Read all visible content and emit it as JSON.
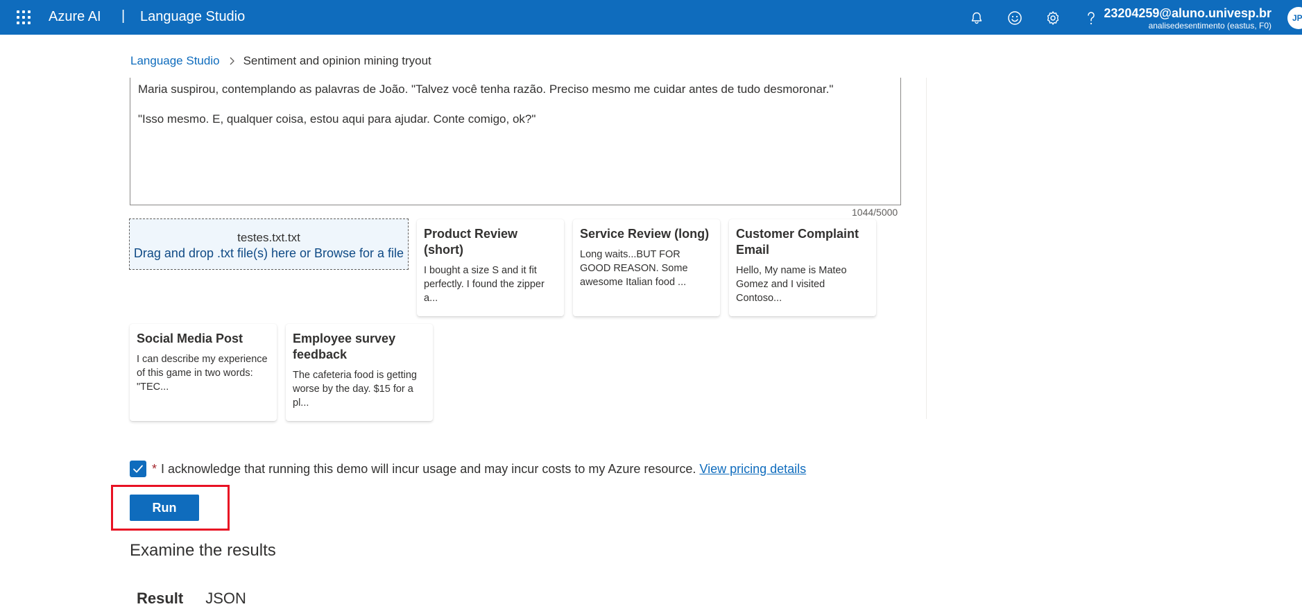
{
  "header": {
    "brand": "Azure AI",
    "separator": "|",
    "product": "Language Studio",
    "account_email": "23204259@aluno.univesp.br",
    "account_resource": "analisedesentimento (eastus, F0)",
    "avatar_initials": "JP",
    "icons": [
      "notifications-icon",
      "feedback-icon",
      "settings-icon",
      "help-icon"
    ]
  },
  "breadcrumb": {
    "root": "Language Studio",
    "current": "Sentiment and opinion mining tryout"
  },
  "editor": {
    "lines": [
      "Maria suspirou, contemplando as palavras de João. \"Talvez você tenha razão. Preciso mesmo me cuidar antes de tudo desmoronar.\"",
      "\"Isso mesmo. E, qualquer coisa, estou aqui para ajudar. Conte comigo, ok?\""
    ],
    "char_count": "1044/5000"
  },
  "upload": {
    "file_name": "testes.txt.txt",
    "hint": "Drag and drop .txt file(s) here or Browse for a file"
  },
  "samples": [
    {
      "title": "Product Review (short)",
      "body": "I bought a size S and it fit perfectly. I found the zipper a..."
    },
    {
      "title": "Service Review (long)",
      "body": "Long waits...BUT FOR GOOD REASON. Some awesome Italian food ..."
    },
    {
      "title": "Customer Complaint Email",
      "body": "Hello, My name is Mateo Gomez and I visited Contoso..."
    },
    {
      "title": "Social Media Post",
      "body": "I can describe my experience of this game in two words: \"TEC..."
    },
    {
      "title": "Employee survey feedback",
      "body": "The cafeteria food is getting worse by the day. $15 for a pl..."
    }
  ],
  "acknowledge": {
    "checked": true,
    "required_mark": "*",
    "text": "I acknowledge that running this demo will incur usage and may incur costs to my Azure resource.",
    "link": "View pricing details"
  },
  "run_button": "Run",
  "results": {
    "title": "Examine the results",
    "tabs": [
      "Result",
      "JSON"
    ],
    "active_tab": "Result"
  },
  "colors": {
    "accent": "#0f6cbd",
    "highlight_box": "#e81123",
    "required": "#a4262c"
  }
}
